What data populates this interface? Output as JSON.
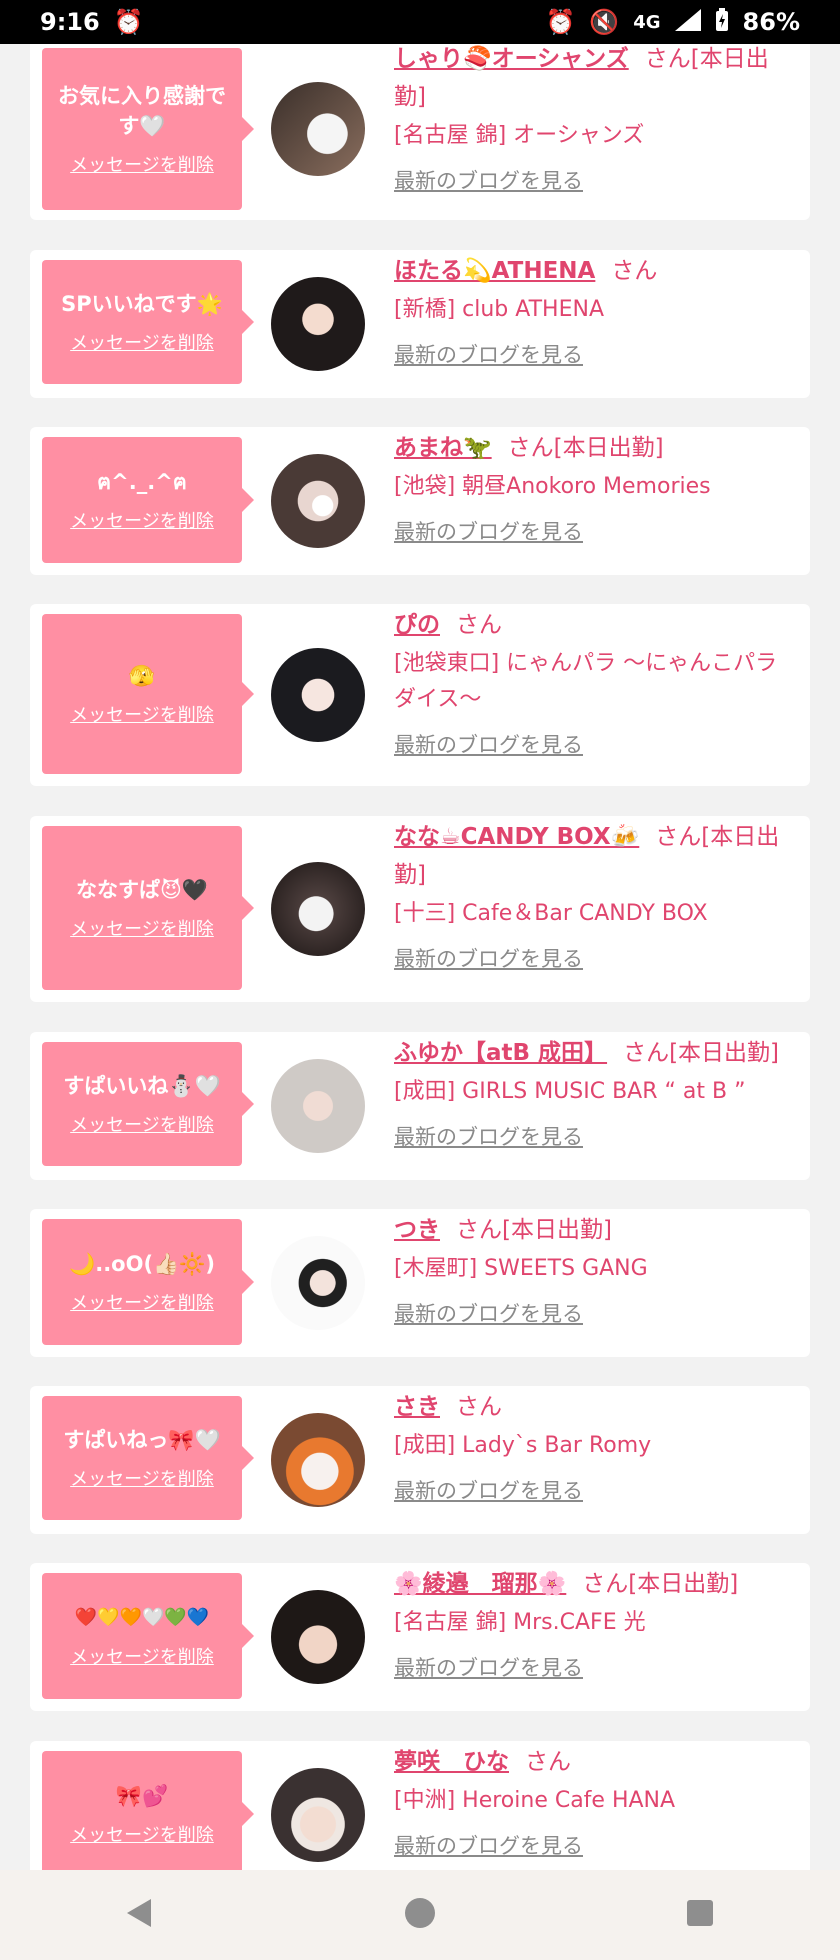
{
  "status": {
    "time": "9:16",
    "network": "4G",
    "battery": "86%"
  },
  "colors": {
    "accent": "#e0456e",
    "bubble": "#ff8fa3",
    "background": "#f2f2f2"
  },
  "common": {
    "delete_label": "メッセージを削除",
    "blog_label": "最新のブログを見る"
  },
  "cards": [
    {
      "message": "お気に入り感謝です🤍",
      "name": "しゃり🍣オーシャンズ",
      "suffix": "さん[本日出勤]",
      "shop": "[名古屋 錦] オーシャンズ"
    },
    {
      "message": "SPいいねです🌟",
      "name": "ほたる💫ATHENA",
      "suffix": "さん",
      "shop": "[新橋] club ATHENA"
    },
    {
      "message": "ฅ^._.^ฅ",
      "name": "あまね🦖",
      "suffix": "さん[本日出勤]",
      "shop": "[池袋] 朝昼Anokoro Memories"
    },
    {
      "message": "🫣",
      "name": "ぴの",
      "suffix": "さん",
      "shop": "[池袋東口] にゃんパラ 〜にゃんこパラダイス〜"
    },
    {
      "message": "ななすぱ😈🖤",
      "name": "なな☕CANDY BOX🍻",
      "suffix": "さん[本日出勤]",
      "shop": "[十三] Cafe＆Bar CANDY BOX"
    },
    {
      "message": "すぱいいね⛄🤍",
      "name": "ふゆか【atB 成田】",
      "suffix": "さん[本日出勤]",
      "shop": "[成田] GIRLS MUSIC BAR “ at B ”"
    },
    {
      "message": "🌙..oO(👍🏻🔆)",
      "name": "つき",
      "suffix": "さん[本日出勤]",
      "shop": "[木屋町] SWEETS GANG"
    },
    {
      "message": "すぱいねっ🎀🤍",
      "name": "さき",
      "suffix": "さん",
      "shop": "[成田] Lady`s Bar Romy"
    },
    {
      "message": "❤️💛🧡🤍💚💙",
      "name": "🌸綾邉　瑠那🌸",
      "suffix": "さん[本日出勤]",
      "shop": "[名古屋 錦] Mrs.CAFE 光"
    },
    {
      "message": "🎀💕",
      "name": "夢咲　ひな",
      "suffix": "さん",
      "shop": "[中洲] Heroine Cafe HANA"
    }
  ],
  "icons": {
    "status": [
      "alarm-icon",
      "mute-icon",
      "signal-icon",
      "battery-icon"
    ],
    "nav": [
      "back-icon",
      "home-icon",
      "recents-icon"
    ]
  }
}
